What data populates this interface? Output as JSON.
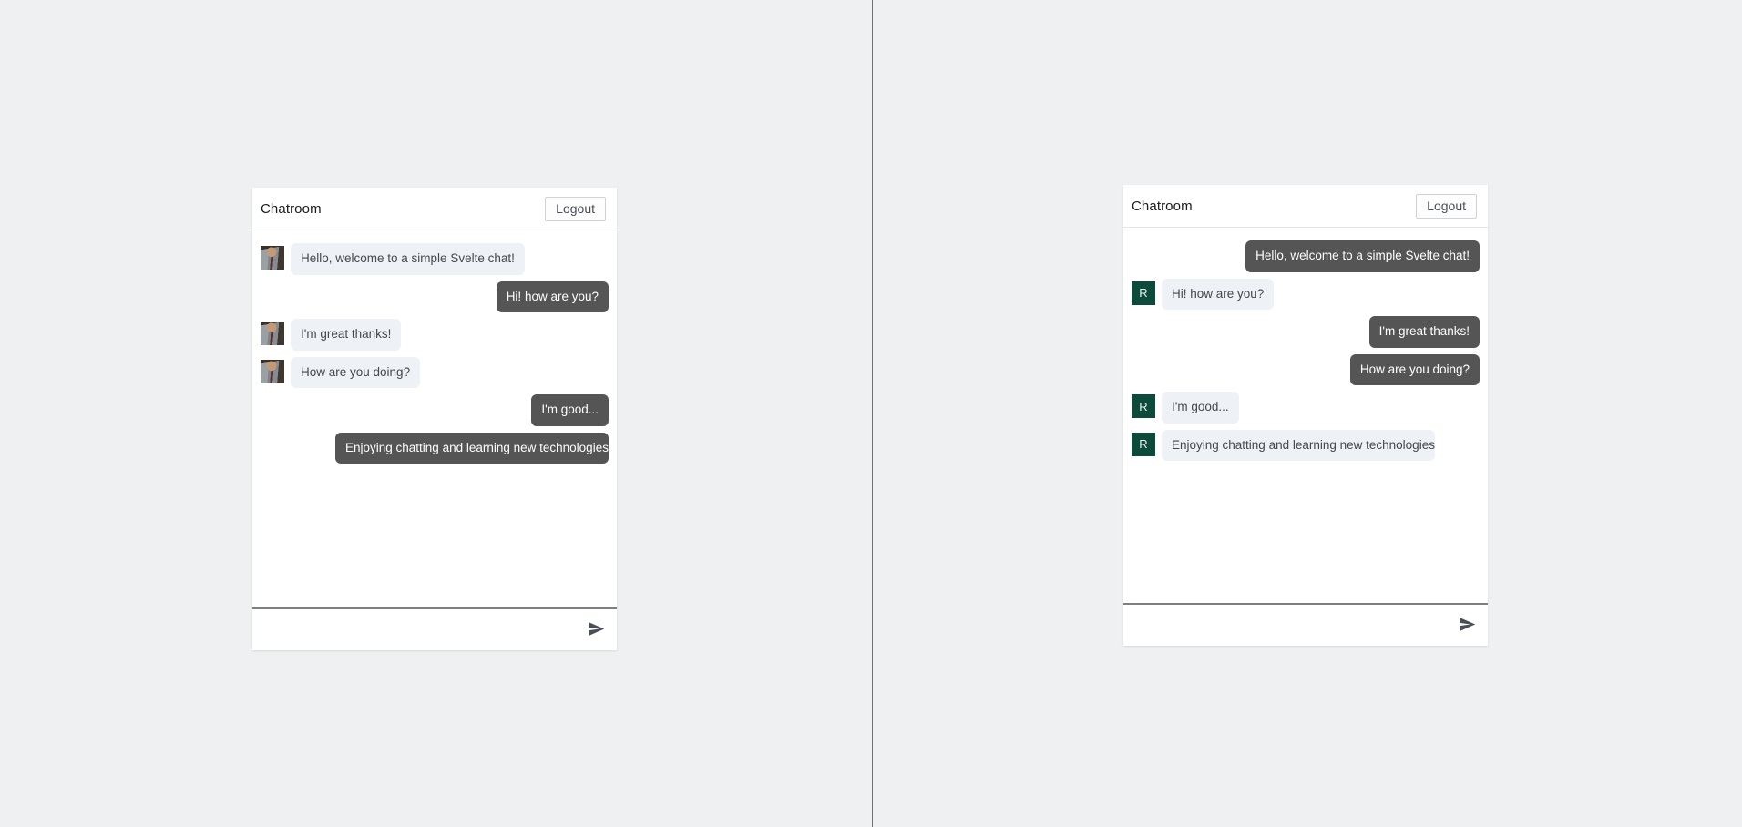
{
  "app": {
    "background_color": "#eff0f2",
    "card_background": "#ffffff",
    "incoming_bubble_color": "#eef1f5",
    "outgoing_bubble_color": "#555555",
    "avatar_initial_color": "#0c4b3b",
    "divider_color": "#6f7175"
  },
  "panels": {
    "left": {
      "header": {
        "title": "Chatroom",
        "logout_label": "Logout"
      },
      "messages": [
        {
          "text": "Hello, welcome to a simple Svelte chat!",
          "side": "left",
          "avatar": "photo",
          "avatar_label": ""
        },
        {
          "text": "Hi! how are you?",
          "side": "right",
          "avatar": "none",
          "avatar_label": ""
        },
        {
          "text": "I'm great thanks!",
          "side": "left",
          "avatar": "photo",
          "avatar_label": ""
        },
        {
          "text": "How are you doing?",
          "side": "left",
          "avatar": "photo",
          "avatar_label": ""
        },
        {
          "text": "I'm good...",
          "side": "right",
          "avatar": "none",
          "avatar_label": ""
        },
        {
          "text": "Enjoying chatting and learning new technologies",
          "side": "right",
          "avatar": "none",
          "avatar_label": ""
        }
      ],
      "composer": {
        "value": "",
        "placeholder": "",
        "send_icon": "paper-plane-icon"
      }
    },
    "right": {
      "header": {
        "title": "Chatroom",
        "logout_label": "Logout"
      },
      "messages": [
        {
          "text": "Hello, welcome to a simple Svelte chat!",
          "side": "right",
          "avatar": "none",
          "avatar_label": ""
        },
        {
          "text": "Hi! how are you?",
          "side": "left",
          "avatar": "initial",
          "avatar_label": "R"
        },
        {
          "text": "I'm great thanks!",
          "side": "right",
          "avatar": "none",
          "avatar_label": ""
        },
        {
          "text": "How are you doing?",
          "side": "right",
          "avatar": "none",
          "avatar_label": ""
        },
        {
          "text": "I'm good...",
          "side": "left",
          "avatar": "initial",
          "avatar_label": "R"
        },
        {
          "text": "Enjoying chatting and learning new technologies",
          "side": "left",
          "avatar": "initial",
          "avatar_label": "R"
        }
      ],
      "composer": {
        "value": "",
        "placeholder": "",
        "send_icon": "paper-plane-icon"
      }
    }
  }
}
